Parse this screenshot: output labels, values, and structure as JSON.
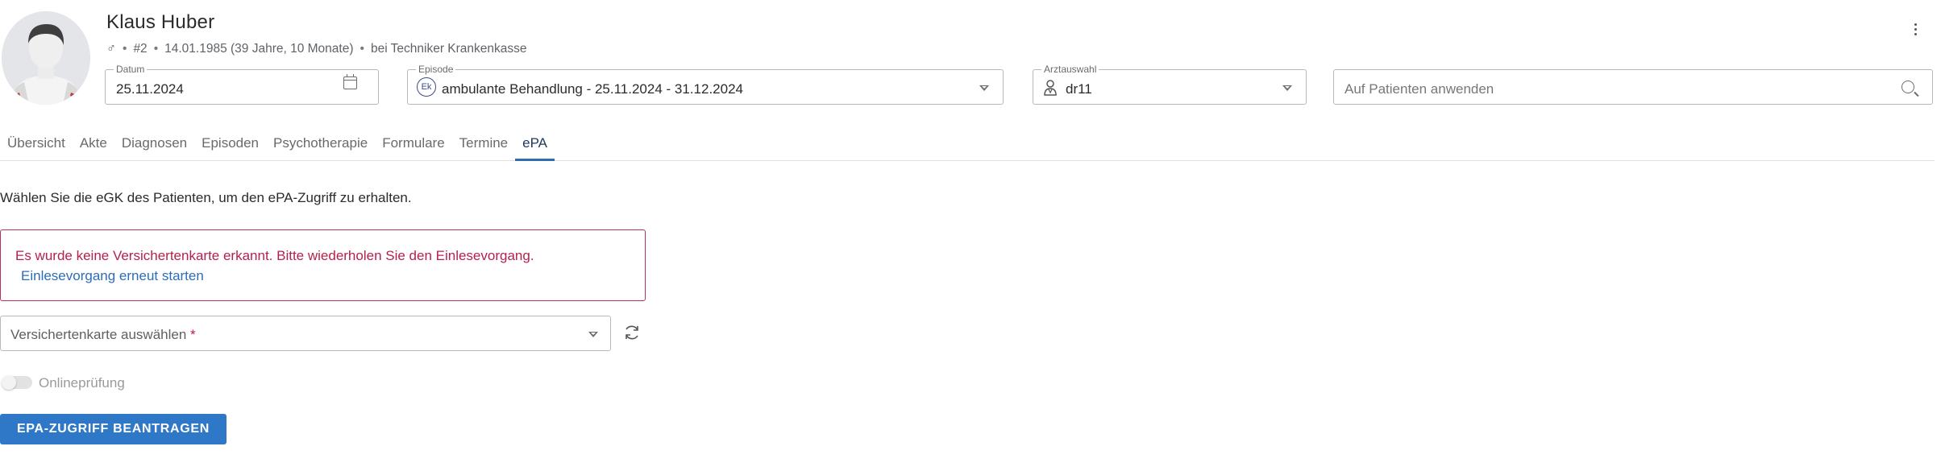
{
  "patient": {
    "name": "Klaus Huber",
    "gender_symbol": "♂",
    "id": "#2",
    "birth": "14.01.1985 (39 Jahre, 10 Monate)",
    "insurance": "bei Techniker Krankenkasse"
  },
  "icons": {
    "avatar": "person-avatar",
    "calendar": "calendar-icon",
    "episode_badge": "Ek",
    "doctor": "person-icon",
    "search": "search-icon",
    "more": "kebab-menu-icon",
    "refresh": "refresh-icon"
  },
  "fields": {
    "datum": {
      "label": "Datum",
      "value": "25.11.2024"
    },
    "episode": {
      "label": "Episode",
      "badge": "Ek",
      "value": "ambulante Behandlung - 25.11.2024 - 31.12.2024"
    },
    "arzt": {
      "label": "Arztauswahl",
      "value": "dr11"
    },
    "apply": {
      "placeholder": "Auf Patienten anwenden"
    }
  },
  "tabs": [
    {
      "label": "Übersicht"
    },
    {
      "label": "Akte"
    },
    {
      "label": "Diagnosen"
    },
    {
      "label": "Episoden"
    },
    {
      "label": "Psychotherapie"
    },
    {
      "label": "Formulare"
    },
    {
      "label": "Termine"
    },
    {
      "label": "ePA",
      "active": true
    }
  ],
  "main": {
    "instruction": "Wählen Sie die eGK des Patienten, um den ePA-Zugriff zu erhalten.",
    "alert": {
      "message": "Es wurde keine Versichertenkarte erkannt. Bitte wiederholen Sie den Einlesevorgang.",
      "link": "Einlesevorgang erneut starten"
    },
    "card_select": {
      "placeholder": "Versichertenkarte auswählen",
      "required_mark": "*"
    },
    "online_check": {
      "label": "Onlineprüfung",
      "enabled": false
    },
    "request_button": "EPA-ZUGRIFF BEANTRAGEN"
  },
  "colors": {
    "accent": "#2f77c7",
    "error": "#b5214c",
    "tab_active": "#2d6db5"
  }
}
